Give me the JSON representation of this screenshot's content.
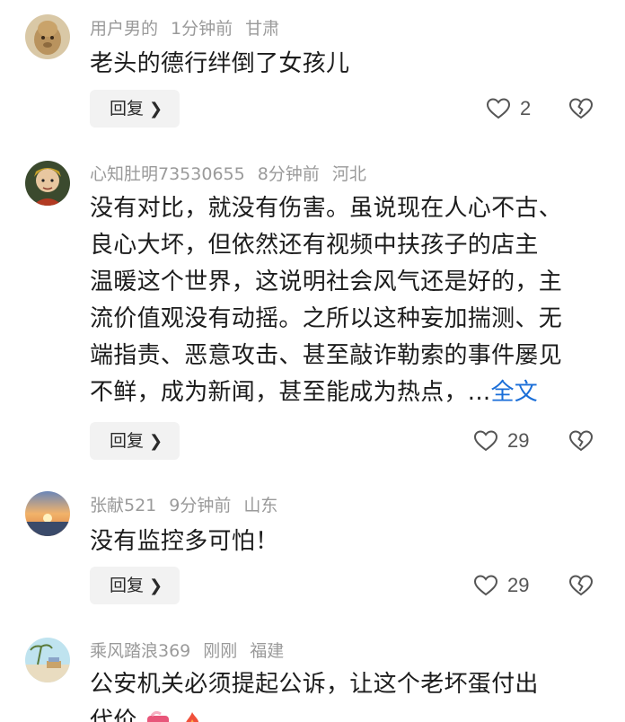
{
  "comments": [
    {
      "username": "用户男的",
      "time": "1分钟前",
      "location": "甘肃",
      "text_lines": [
        "老头的德行绊倒了女孩儿"
      ],
      "reply_label": "回复",
      "likes": "2"
    },
    {
      "username": "心知肚明73530655",
      "time": "8分钟前",
      "location": "河北",
      "text_lines": [
        "没有对比，就没有伤害。虽说现在人心不古、",
        "良心大坏，但依然还有视频中扶孩子的店主",
        "温暖这个世界，这说明社会风气还是好的，主",
        "流价值观没有动摇。之所以这种妄加揣测、无",
        "端指责、恶意攻击、甚至敲诈勒索的事件屡见",
        "不鲜，成为新闻，甚至能成为热点，..."
      ],
      "more_label": "全文",
      "reply_label": "回复",
      "likes": "29"
    },
    {
      "username": "张献521",
      "time": "9分钟前",
      "location": "山东",
      "text_lines": [
        "没有监控多可怕！"
      ],
      "reply_label": "回复",
      "likes": "29"
    },
    {
      "username": "乘风踏浪369",
      "time": "刚刚",
      "location": "福建",
      "text_lines": [
        "公安机关必须提起公诉，让这个老坏蛋付出",
        "代价"
      ],
      "emojis": [
        "strong-arm-emoji",
        "fire-emoji"
      ]
    }
  ],
  "icons": {
    "like": "heart-outline-icon",
    "dislike": "broken-heart-outline-icon",
    "reply_chevron": "chevron-right-icon"
  },
  "colors": {
    "meta": "#9a9a9a",
    "link": "#1a6ed8",
    "reply_bg": "#f2f2f2"
  }
}
